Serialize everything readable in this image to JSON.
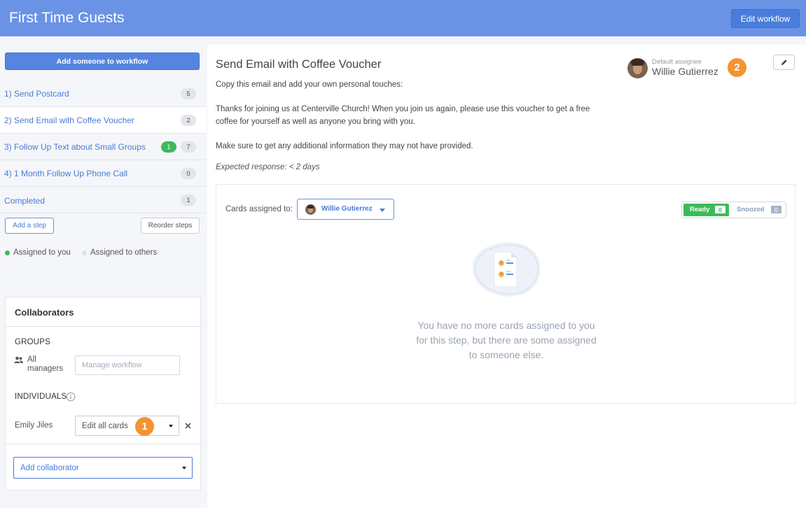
{
  "header": {
    "title": "First Time Guests",
    "edit_workflow": "Edit workflow"
  },
  "sidebar": {
    "add_someone": "Add someone to workflow",
    "steps": [
      {
        "label": "1) Send Postcard",
        "count": "5"
      },
      {
        "label": "2) Send Email with Coffee Voucher",
        "count": "2"
      },
      {
        "label": "3) Follow Up Text about Small Groups",
        "mine": "1",
        "count": "7"
      },
      {
        "label": "4) 1 Month Follow Up Phone Call",
        "count": "0"
      },
      {
        "label": "Completed",
        "count": "1"
      }
    ],
    "add_step": "Add a step",
    "reorder": "Reorder steps",
    "legend_you": "Assigned to you",
    "legend_others": "Assigned to others"
  },
  "collaborators": {
    "title": "Collaborators",
    "groups_heading": "GROUPS",
    "group_name_1": "All",
    "group_name_2": "managers",
    "group_placeholder": "Manage workflow",
    "individuals_heading": "INDIVIDUALS",
    "individual_name": "Emily Jiles",
    "individual_permission": "Edit all cards",
    "add_collaborator": "Add collaborator"
  },
  "badges": {
    "one": "1",
    "two": "2"
  },
  "main": {
    "step_title": "Send Email with Coffee Voucher",
    "intro": "Copy this email and add your own personal touches:",
    "email_line1": "Thanks for joining us at Centerville Church! When you join us again, please use this voucher to get a free",
    "email_line2": "coffee for yourself as well as anyone you bring with you.",
    "note": "Make sure to get any additional information they may not have provided.",
    "expected": "Expected response: < 2 days",
    "default_assignee_label": "Default assignee",
    "default_assignee_name": "Willie Gutierrez"
  },
  "cards": {
    "assigned_label": "Cards assigned to:",
    "assignee": "Willie Gutierrez",
    "ready_label": "Ready",
    "ready_count": "0",
    "snoozed_label": "Snoozed",
    "snoozed_count": "0",
    "empty_line1": "You have no more cards assigned to you",
    "empty_line2": "for this step, but there are some assigned",
    "empty_line3": "to someone else."
  },
  "colors": {
    "header": "#6a93e6",
    "primary": "#5585e0",
    "ready": "#3cba5a",
    "badge": "#f39332"
  }
}
